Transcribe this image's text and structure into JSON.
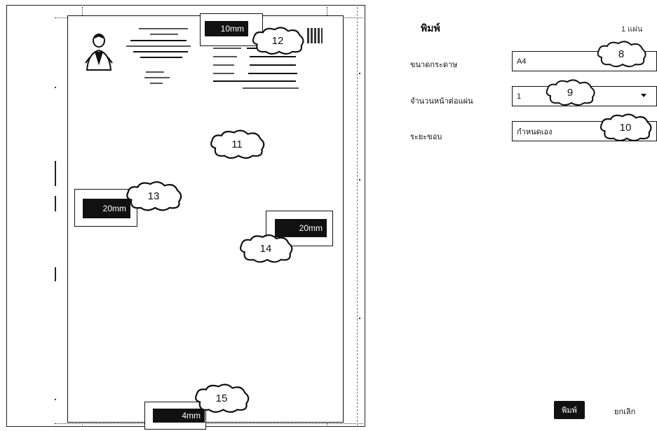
{
  "preview": {
    "margins": {
      "top": "10mm",
      "left": "20mm",
      "right": "20mm",
      "bottom": "4mm"
    }
  },
  "callouts": {
    "c8": "8",
    "c9": "9",
    "c10": "10",
    "c11": "11",
    "c12": "12",
    "c13": "13",
    "c14": "14",
    "c15": "15"
  },
  "panel": {
    "title": "พิมพ์",
    "sheet_count": "1 แผ่น",
    "fields": {
      "paper_size_label": "ขนาดกระดาษ",
      "paper_size_value": "A4",
      "pages_per_sheet_label": "จำนวนหน้าต่อแผ่น",
      "pages_per_sheet_value": "1",
      "margins_label": "ระยะขอบ",
      "margins_value": "กำหนดเอง"
    },
    "print_button": "พิมพ์",
    "cancel_button": "ยกเลิก"
  },
  "colors": {
    "ink": "#111111",
    "paper": "#ffffff"
  },
  "icons": {
    "profile_photo": "person-photo-icon",
    "qr": "qr-code-icon",
    "dropdown": "chevron-down-icon"
  }
}
